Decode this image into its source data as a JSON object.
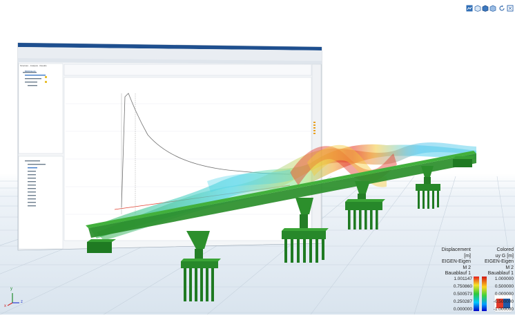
{
  "toolbar": {
    "buttons": [
      {
        "name": "snapshot-icon"
      },
      {
        "name": "view-box-icon"
      },
      {
        "name": "view-cube-icon"
      },
      {
        "name": "view-iso-icon"
      },
      {
        "name": "rotate-icon"
      },
      {
        "name": "fullscreen-icon"
      }
    ]
  },
  "embedded_window": {
    "sidebar_tabs": [
      "Structure",
      "Analysis",
      "Results"
    ],
    "tree_root": "BRIDGE-01"
  },
  "legend": {
    "left": {
      "lines": [
        "Displacement",
        "[m]",
        "EIGEN-Eigen",
        "M 2",
        "Bauablauf 1"
      ],
      "values": [
        "1.001147",
        "0.750860",
        "0.500573",
        "0.250287",
        "0.000000"
      ]
    },
    "right": {
      "lines": [
        "Colored",
        "uy G [m]",
        "EIGEN-Eigen",
        "M 2",
        "Bauablauf 1"
      ],
      "values": [
        "1.000000",
        "0.500000",
        "0.000000",
        "-0.500000",
        "-1.000000"
      ]
    }
  },
  "axes": {
    "x": "x",
    "y": "y",
    "z": "z"
  },
  "colors": {
    "structure": "#2e8b2e",
    "grid": "#c7d3df",
    "accent": "#1e5aa8"
  }
}
